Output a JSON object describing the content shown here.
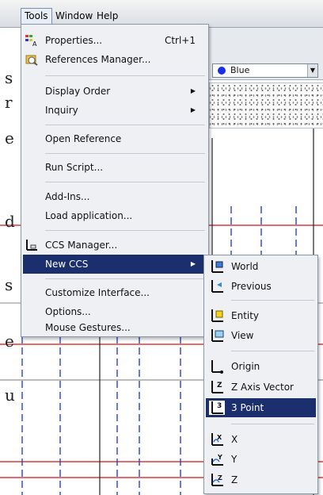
{
  "menubar": {
    "items": [
      "Tools",
      "Window",
      "Help"
    ]
  },
  "background": {
    "fragments": [
      "s",
      "r",
      "e",
      "d",
      "s",
      "e",
      "u"
    ]
  },
  "toolbar": {
    "color_value": "Blue",
    "color_hex": "#1a2ee6"
  },
  "tools_menu": {
    "properties": {
      "label": "Properties...",
      "shortcut": "Ctrl+1"
    },
    "references_manager": "References Manager...",
    "display_order": "Display Order",
    "inquiry": "Inquiry",
    "open_reference": "Open Reference",
    "run_script": "Run Script...",
    "add_ins": "Add-Ins...",
    "load_application": "Load application...",
    "ccs_manager": "CCS Manager...",
    "new_ccs": "New CCS",
    "customize_interface": "Customize Interface...",
    "options": "Options...",
    "mouse_gestures": "Mouse Gestures..."
  },
  "new_ccs_menu": {
    "world": "World",
    "previous": "Previous",
    "entity": "Entity",
    "view": "View",
    "origin": "Origin",
    "z_axis_vector": "Z Axis Vector",
    "three_point": "3 Point",
    "x": "X",
    "y": "Y",
    "z": "Z"
  },
  "colors": {
    "highlight": "#1b2f6e",
    "menu_bg": "#eef0f3",
    "grid_blue": "#2a3fd8",
    "grid_red": "#d83a3a"
  }
}
